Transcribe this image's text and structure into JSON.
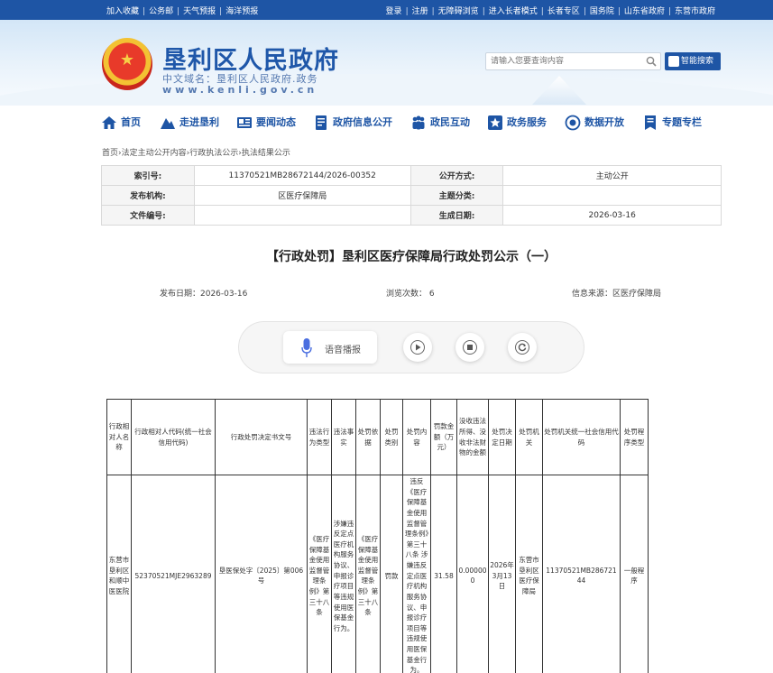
{
  "topbar": {
    "left": [
      "加入收藏",
      "公务邮",
      "天气预报",
      "海洋预报"
    ],
    "right": [
      "登录",
      "注册",
      "无障碍浏览",
      "进入长者模式",
      "长者专区",
      "国务院",
      "山东省政府",
      "东营市政府"
    ]
  },
  "header": {
    "site_name": "垦利区人民政府",
    "domain_line": "中文域名：垦利区人民政府.政务",
    "domain_url": "www.kenli.gov.cn",
    "search_placeholder": "请输入您要查询内容",
    "smart_search": "智能搜索"
  },
  "nav": [
    {
      "label": "首页",
      "icon": "home-icon"
    },
    {
      "label": "走进垦利",
      "icon": "mountain-icon"
    },
    {
      "label": "要闻动态",
      "icon": "news-icon"
    },
    {
      "label": "政府信息公开",
      "icon": "document-icon"
    },
    {
      "label": "政民互动",
      "icon": "people-icon"
    },
    {
      "label": "政务服务",
      "icon": "star-badge-icon"
    },
    {
      "label": "数据开放",
      "icon": "data-globe-icon"
    },
    {
      "label": "专题专栏",
      "icon": "column-icon"
    }
  ],
  "breadcrumb": [
    "首页",
    "法定主动公开内容",
    "行政执法公示",
    "执法结果公示"
  ],
  "meta": {
    "index_label": "索引号:",
    "index_value": "11370521MB28672144/2026-00352",
    "open_mode_label": "公开方式:",
    "open_mode_value": "主动公开",
    "publisher_label": "发布机构:",
    "publisher_value": "区医疗保障局",
    "topic_label": "主题分类:",
    "topic_value": "",
    "doc_no_label": "文件编号:",
    "doc_no_value": "",
    "created_label": "生成日期:",
    "created_value": "2026-03-16"
  },
  "article": {
    "title": "【行政处罚】垦利区医疗保障局行政处罚公示（一）",
    "publish_date": "发布日期：2026-03-16",
    "views": "浏览次数： 6",
    "source": "信息来源：区医疗保障局"
  },
  "player": {
    "tts_label": "语音播报"
  },
  "penalty_table": {
    "headers": [
      "行政相对人名称",
      "行政相对人代码(统一社会信用代码)",
      "行政处罚决定书文号",
      "违法行为类型",
      "违法事实",
      "处罚依据",
      "处罚类别",
      "处罚内容",
      "罚款金额（万元）",
      "没收违法所得、没收非法财物的金额",
      "处罚决定日期",
      "处罚机关",
      "处罚机关统一社会信用代码",
      "处罚程序类型"
    ],
    "rows": [
      [
        "东营市垦利区和顺中医医院",
        "52370521MJE2963289",
        "垦医保处字〔2025〕第006号",
        "《医疗保障基金使用监督管理条例》第三十八条",
        "涉嫌违反定点医疗机构服务协议、申报诊疗项目等违规使用医保基金行为。",
        "《医疗保障基金使用监督管理条例》第三十八条",
        "罚款",
        "违反《医疗保障基金使用监督管理条例》第三十八条 涉嫌违反定点医疗机构服务协议、申报诊疗项目等违规使用医保基金行为。",
        "31.58",
        "0.000000",
        "2026年3月13日",
        "东营市垦利区医疗保障局",
        "11370521MB28672144",
        "一般程序"
      ]
    ]
  }
}
